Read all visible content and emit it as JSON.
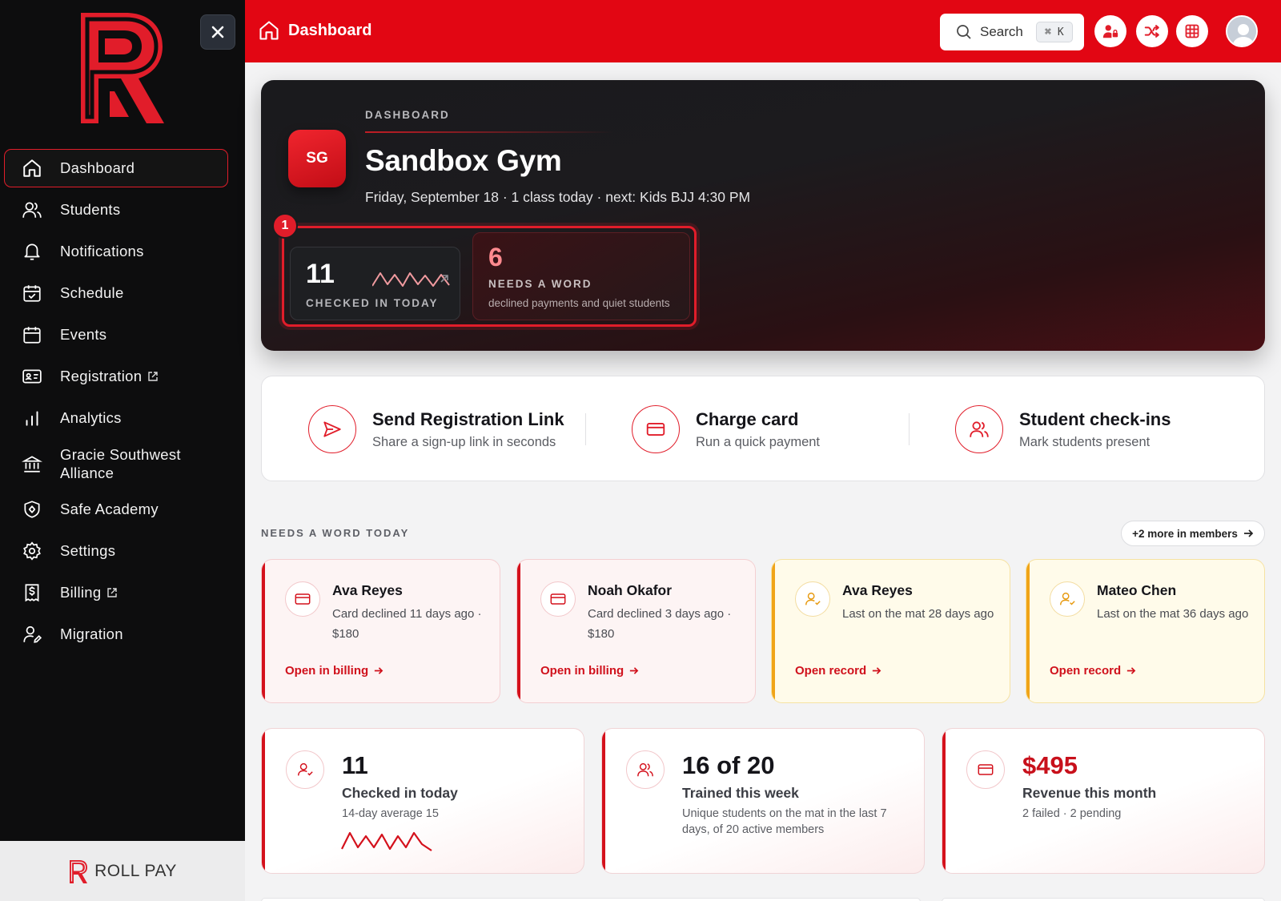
{
  "sidebar": {
    "brand": "ROLL PAY",
    "items": [
      {
        "label": "Dashboard",
        "icon": "home-icon"
      },
      {
        "label": "Students",
        "icon": "users-icon"
      },
      {
        "label": "Notifications",
        "icon": "bell-icon"
      },
      {
        "label": "Schedule",
        "icon": "calendar-check-icon"
      },
      {
        "label": "Events",
        "icon": "calendar-icon"
      },
      {
        "label": "Registration",
        "icon": "id-card-icon",
        "external": true
      },
      {
        "label": "Analytics",
        "icon": "bar-chart-icon"
      },
      {
        "label": "Gracie Southwest Alliance",
        "icon": "institution-icon"
      },
      {
        "label": "Safe Academy",
        "icon": "shield-icon"
      },
      {
        "label": "Settings",
        "icon": "gear-icon"
      },
      {
        "label": "Billing",
        "icon": "billing-icon",
        "external": true
      },
      {
        "label": "Migration",
        "icon": "user-edit-icon"
      }
    ]
  },
  "topbar": {
    "title": "Dashboard",
    "search": {
      "label": "Search",
      "shortcut_mod": "⌘",
      "shortcut_key": "K"
    },
    "accent": "#e20613"
  },
  "hero": {
    "eyebrow": "DASHBOARD",
    "badge": "SG",
    "gym_name": "Sandbox Gym",
    "subtitle": "Friday, September 18 · 1 class today · next: Kids BJJ 4:30 PM",
    "step": "1",
    "checked_in": {
      "value": "11",
      "label": "CHECKED IN TODAY"
    },
    "needs_word": {
      "value": "6",
      "label": "NEEDS A WORD",
      "desc": "declined payments and quiet students"
    }
  },
  "actions": [
    {
      "title": "Send Registration Link",
      "desc": "Share a sign-up link in seconds",
      "icon": "send-icon"
    },
    {
      "title": "Charge card",
      "desc": "Run a quick payment",
      "icon": "credit-card-icon"
    },
    {
      "title": "Student check-ins",
      "desc": "Mark students present",
      "icon": "users-icon"
    }
  ],
  "needs_word": {
    "label": "NEEDS A WORD TODAY",
    "more": "+2 more in members",
    "cards": [
      {
        "name": "Ava Reyes",
        "desc": "Card declined 11 days ago · $180",
        "link": "Open in billing",
        "tone": "red"
      },
      {
        "name": "Noah Okafor",
        "desc": "Card declined 3 days ago · $180",
        "link": "Open in billing",
        "tone": "red"
      },
      {
        "name": "Ava Reyes",
        "desc": "Last on the mat 28 days ago",
        "link": "Open record",
        "tone": "amber"
      },
      {
        "name": "Mateo Chen",
        "desc": "Last on the mat 36 days ago",
        "link": "Open record",
        "tone": "amber"
      }
    ]
  },
  "stats": [
    {
      "value": "11",
      "label": "Checked in today",
      "sub": "14-day average 15"
    },
    {
      "value": "16 of 20",
      "label": "Trained this week",
      "sub": "Unique students on the mat in the last 7 days, of 20 active members"
    },
    {
      "value": "$495",
      "label": "Revenue this month",
      "sub": "2 failed · 2 pending"
    }
  ]
}
